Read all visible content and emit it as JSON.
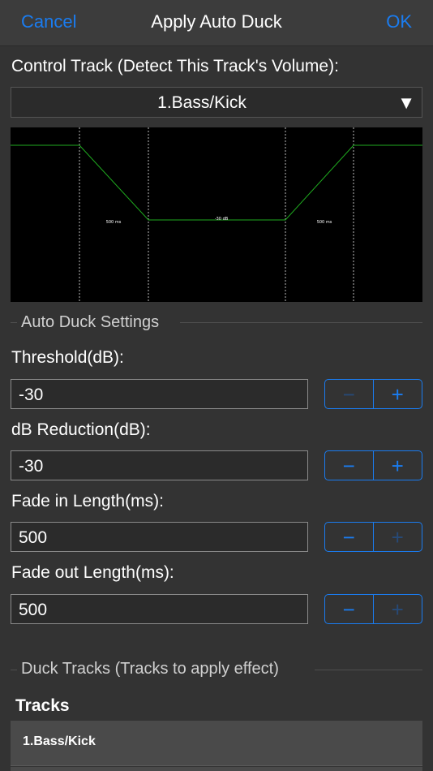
{
  "nav": {
    "cancel_label": "Cancel",
    "title": "Apply Auto Duck",
    "ok_label": "OK"
  },
  "control_track": {
    "label": "Control Track (Detect This Track's Volume):",
    "selected": "1.Bass/Kick",
    "arrow": "▼"
  },
  "graph": {
    "fade_in_annotation": "500 ms",
    "reduction_annotation": "-30 dB",
    "fade_out_annotation": "500 ms",
    "line_color": "#1faa1f",
    "divider_color": "#bbbbbb"
  },
  "settings": {
    "section_title": "Auto Duck Settings",
    "threshold": {
      "label": "Threshold(dB):",
      "value": "-30",
      "minus": "−",
      "plus": "+"
    },
    "reduction": {
      "label": "dB Reduction(dB):",
      "value": "-30",
      "minus": "−",
      "plus": "+"
    },
    "fade_in": {
      "label": "Fade in Length(ms):",
      "value": "500",
      "minus": "−",
      "plus": "+"
    },
    "fade_out": {
      "label": "Fade out Length(ms):",
      "value": "500",
      "minus": "−",
      "plus": "+"
    }
  },
  "duck_tracks": {
    "section_title": "Duck Tracks (Tracks to apply effect)",
    "list_header": "Tracks",
    "items": [
      {
        "label": "1.Bass/Kick"
      }
    ]
  },
  "colors": {
    "accent": "#1a7cf0",
    "background": "#333333",
    "navbar": "#3c3c3c"
  }
}
